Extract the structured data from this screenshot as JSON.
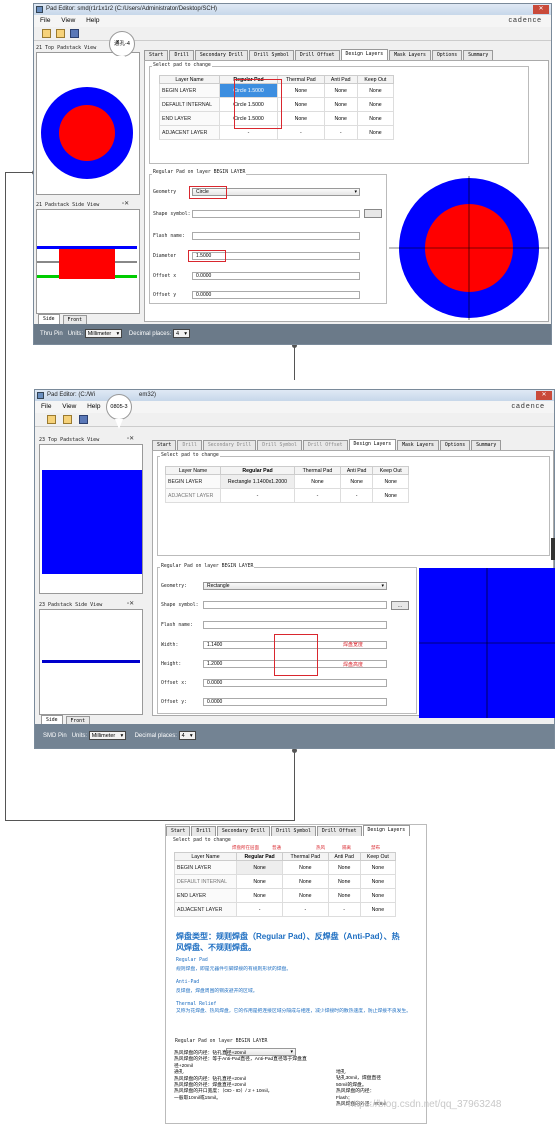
{
  "win1": {
    "title": "Pad Editor: smd(r1r1x1r2  (C:/Users/Administrator/Desktop/SCH)",
    "menu": [
      "File",
      "View",
      "Help"
    ],
    "brand": "cadence",
    "top_view_title": "21 Top Padstack View",
    "side_view_title": "21 Padstack Side View",
    "callout": "通孔-4",
    "tabs": [
      "Start",
      "Drill",
      "Secondary Drill",
      "Drill Symbol",
      "Drill Offset",
      "Design Layers",
      "Mask Layers",
      "Options",
      "Summary"
    ],
    "active_tab": "Design Layers",
    "select_pad_label": "Select pad to change",
    "table_headers": [
      "Layer Name",
      "Regular Pad",
      "Thermal Pad",
      "Anti Pad",
      "Keep Out"
    ],
    "rows": [
      {
        "layer": "BEGIN LAYER",
        "regular": "Circle 1.5000",
        "thermal": "None",
        "anti": "None",
        "keep": "None"
      },
      {
        "layer": "DEFAULT INTERNAL",
        "regular": "Circle 1.5000",
        "thermal": "None",
        "anti": "None",
        "keep": "None"
      },
      {
        "layer": "END LAYER",
        "regular": "Circle 1.5000",
        "thermal": "None",
        "anti": "None",
        "keep": "None"
      },
      {
        "layer": "ADJACENT LAYER",
        "regular": "-",
        "thermal": "-",
        "anti": "-",
        "keep": "None"
      }
    ],
    "regular_group_title": "Regular Pad on layer BEGIN LAYER",
    "fields": {
      "geometry_label": "Geometry",
      "geometry_value": "Circle",
      "shape_symbol_label": "Shape symbol:",
      "flash_label": "Flash name:",
      "diameter_label": "Diameter",
      "diameter_value": "1.5000",
      "offset_x_label": "Offset x",
      "offset_x_value": "0.0000",
      "offset_y_label": "Offset y",
      "offset_y_value": "0.0000"
    },
    "side_tabs": [
      "Side",
      "Front"
    ],
    "status": {
      "pin_type": "Thru Pin",
      "units_label": "Units:",
      "units_value": "Millimeter",
      "decimal_label": "Decimal places:",
      "decimal_value": "4"
    }
  },
  "win2": {
    "title": "Pad Editor:  (C:/Wi",
    "title_tail": "em32)",
    "menu": [
      "File",
      "View",
      "Help"
    ],
    "brand": "cadence",
    "top_view_title": "23 Top Padstack View",
    "side_view_title": "23 Padstack Side View",
    "callout": "0805-3",
    "tabs": [
      "Start",
      "Drill",
      "Secondary Drill",
      "Drill Symbol",
      "Drill Offset",
      "Design Layers",
      "Mask Layers",
      "Options",
      "Summary"
    ],
    "active_tab": "Design Layers",
    "select_pad_label": "Select pad to change",
    "table_headers": [
      "Layer Name",
      "Regular Pad",
      "Thermal Pad",
      "Anti Pad",
      "Keep Out"
    ],
    "rows": [
      {
        "layer": "BEGIN LAYER",
        "regular": "Rectangle 1.1400x1.2000",
        "thermal": "None",
        "anti": "None",
        "keep": "None"
      },
      {
        "layer": "ADJACENT LAYER",
        "regular": "-",
        "thermal": "-",
        "anti": "-",
        "keep": "None"
      }
    ],
    "regular_group_title": "Regular Pad on layer BEGIN LAYER",
    "fields": {
      "geometry_label": "Geometry:",
      "geometry_value": "Rectangle",
      "shape_symbol_label": "Shape symbol:",
      "flash_label": "Flash name:",
      "width_label": "Width:",
      "width_value": "1.1400",
      "height_label": "Height:",
      "height_value": "1.2000",
      "offset_x_label": "Offset x:",
      "offset_x_value": "0.0000",
      "offset_y_label": "Offset y:",
      "offset_y_value": "0.0000"
    },
    "red_notes": {
      "width": "焊盘宽度",
      "height": "焊盘高度"
    },
    "side_tabs": [
      "Side",
      "Front"
    ],
    "status": {
      "pin_type": "SMD Pin",
      "units_label": "Units:",
      "units_value": "Millimeter",
      "decimal_label": "Decimal places:",
      "decimal_value": "4"
    }
  },
  "panel3": {
    "tabs": [
      "Start",
      "Drill",
      "Secondary Drill",
      "Drill Symbol",
      "Drill Offset",
      "Design Layers"
    ],
    "active_tab": "Design Layers",
    "select_pad_label": "Select pad to change",
    "col_notes": [
      "焊盘所在层面",
      "普通",
      "热风",
      "隔离",
      "禁布"
    ],
    "table_headers": [
      "Layer Name",
      "Regular Pad",
      "Thermal Pad",
      "Anti Pad",
      "Keep Out"
    ],
    "rows": [
      {
        "layer": "BEGIN LAYER",
        "regular": "None",
        "thermal": "None",
        "anti": "None",
        "keep": "None"
      },
      {
        "layer": "DEFAULT INTERNAL",
        "regular": "None",
        "thermal": "None",
        "anti": "None",
        "keep": "None"
      },
      {
        "layer": "END LAYER",
        "regular": "None",
        "thermal": "None",
        "anti": "None",
        "keep": "None"
      },
      {
        "layer": "ADJACENT LAYER",
        "regular": "-",
        "thermal": "-",
        "anti": "-",
        "keep": "None"
      }
    ],
    "heading": "焊盘类型：规则焊盘（Regular Pad）、反焊盘（Anti-Pad）、热风焊盘、不规则焊盘。",
    "defs": [
      {
        "term": "Regular Pad",
        "text": "规则焊盘，即是元器件引脚焊接的有规则形状的焊盘。"
      },
      {
        "term": "Anti-Pad",
        "text": "反焊盘，焊盘周围的铜皮避开的区域。"
      },
      {
        "term": "Thermal Relief",
        "text": "又称为花焊盘、热风焊盘，它的作用是把连接区域分隔成与相连，减少焊接时的散热速度，防止焊接不良发生。"
      }
    ],
    "group_title": "Regular Pad on layer BEGIN LAYER",
    "notes_left": [
      "热风焊盘的内径：钻孔直径+20mil",
      "热风焊盘的外径：等于Anti-Pad直径，Anti-Pad直径等于焊盘直",
      "径+20mil",
      "通孔",
      "热风焊盘的内径：钻孔直径+20mil",
      "热风焊盘的外径：焊盘直径+20mil",
      "热风焊盘的开口宽度：（OD - ID）/ 2 + 10mil，",
      "一般取10mil或15mil。"
    ],
    "notes_right": [
      "地孔",
      "钻孔30mil，焊盘直径",
      "50mil的焊盘。",
      "热风焊盘的内径：",
      "Flash：",
      "热风焊盘的外径：80mil"
    ],
    "watermark": "https://blog.csdn.net/qq_37963248"
  }
}
